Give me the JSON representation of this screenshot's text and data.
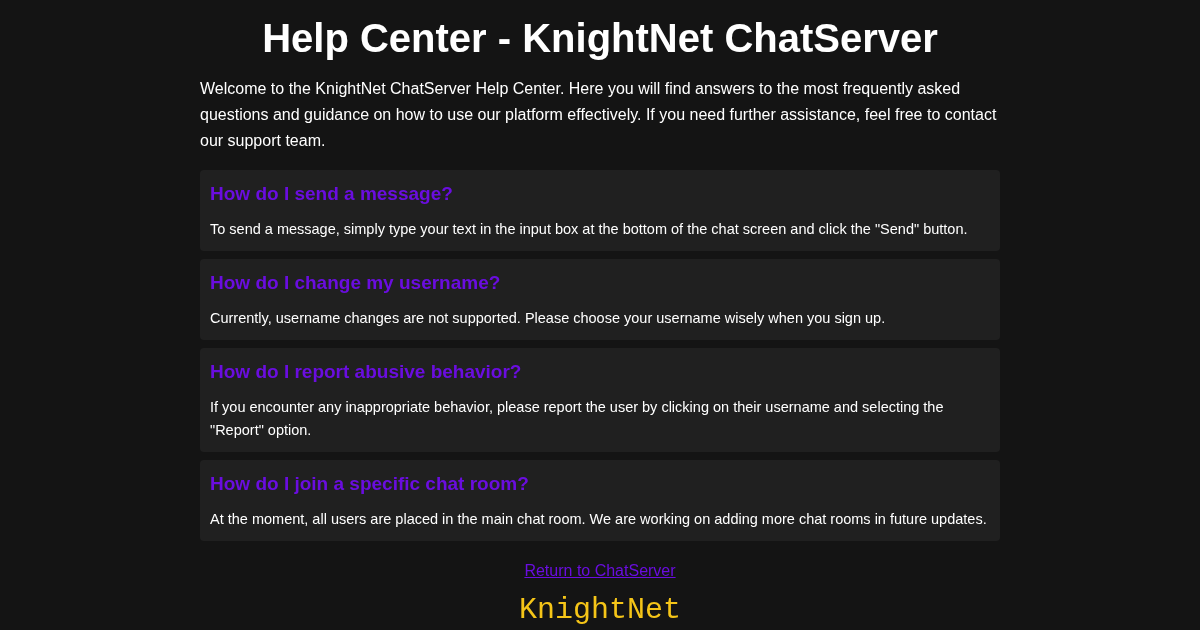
{
  "title": "Help Center - KnightNet ChatServer",
  "intro": "Welcome to the KnightNet ChatServer Help Center. Here you will find answers to the most frequently asked questions and guidance on how to use our platform effectively. If you need further assistance, feel free to contact our support team.",
  "faqs": [
    {
      "question": "How do I send a message?",
      "answer": "To send a message, simply type your text in the input box at the bottom of the chat screen and click the \"Send\" button."
    },
    {
      "question": "How do I change my username?",
      "answer": "Currently, username changes are not supported. Please choose your username wisely when you sign up."
    },
    {
      "question": "How do I report abusive behavior?",
      "answer": "If you encounter any inappropriate behavior, please report the user by clicking on their username and selecting the \"Report\" option."
    },
    {
      "question": "How do I join a specific chat room?",
      "answer": "At the moment, all users are placed in the main chat room. We are working on adding more chat rooms in future updates."
    }
  ],
  "return_link": "Return to ChatServer",
  "footer_logo": "KnightNet"
}
